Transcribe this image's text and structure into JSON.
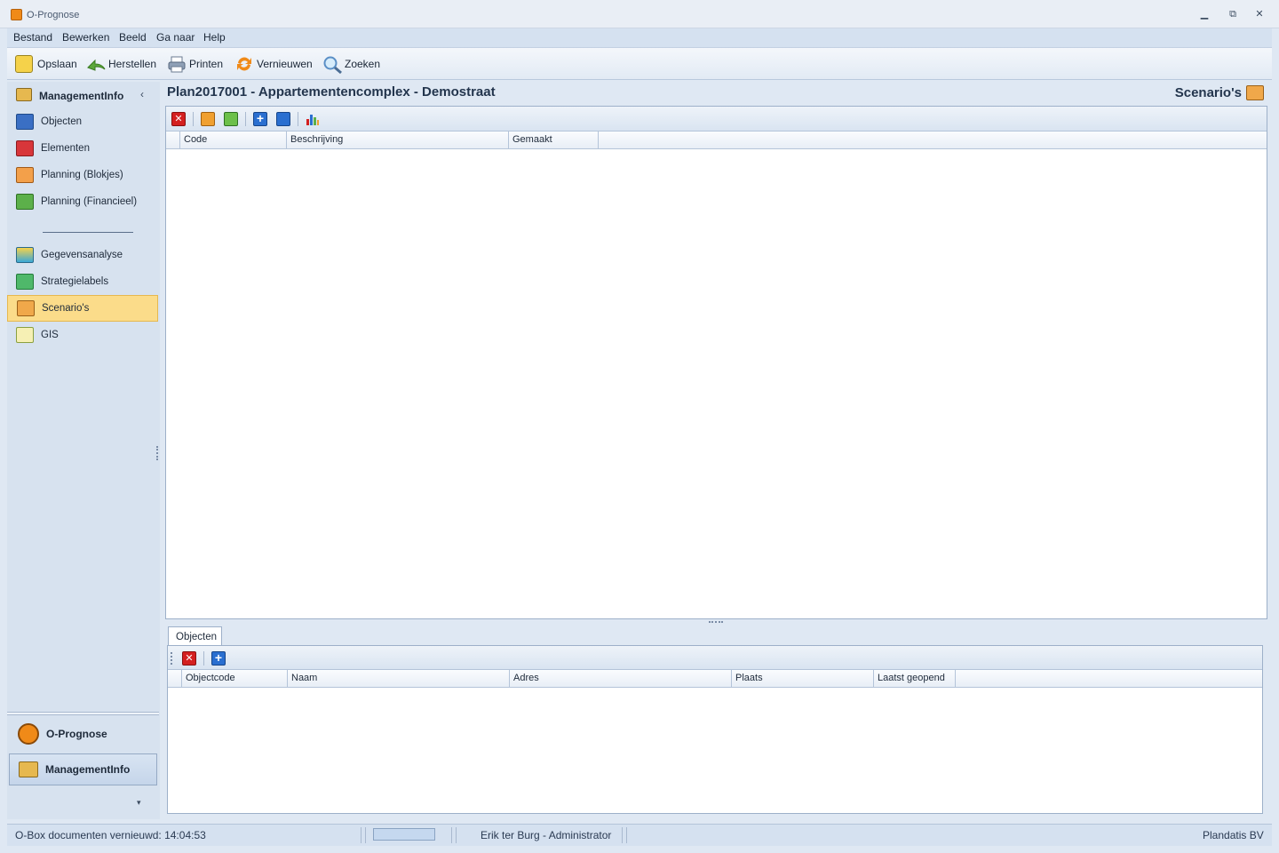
{
  "window": {
    "title": "O-Prognose",
    "controls": [
      "minimize",
      "restore",
      "close"
    ]
  },
  "menu": {
    "items": [
      "Bestand",
      "Bewerken",
      "Beeld",
      "Ga naar",
      "Help"
    ]
  },
  "toolbar": {
    "buttons": [
      {
        "label": "Opslaan",
        "icon": "save-icon"
      },
      {
        "label": "Herstellen",
        "icon": "undo-icon"
      },
      {
        "label": "Printen",
        "icon": "printer-icon"
      },
      {
        "label": "Vernieuwen",
        "icon": "refresh-icon"
      },
      {
        "label": "Zoeken",
        "icon": "search-icon"
      }
    ]
  },
  "nav": {
    "header": "ManagementInfo",
    "items": [
      {
        "label": "Objecten",
        "icon": "objects-icon"
      },
      {
        "label": "Elementen",
        "icon": "elements-icon"
      },
      {
        "label": "Planning (Blokjes)",
        "icon": "planning-blocks-icon"
      },
      {
        "label": "Planning (Financieel)",
        "icon": "planning-financial-icon"
      },
      {
        "label": "Gegevensanalyse",
        "icon": "data-analysis-icon"
      },
      {
        "label": "Strategielabels",
        "icon": "strategy-labels-icon"
      },
      {
        "label": "Scenario's",
        "icon": "scenarios-icon",
        "selected": true
      },
      {
        "label": "GIS",
        "icon": "gis-icon"
      }
    ],
    "bottom_buttons": [
      {
        "label": "O-Prognose",
        "icon": "o-prognose-icon"
      },
      {
        "label": "ManagementInfo",
        "icon": "managementinfo-icon",
        "active": true
      }
    ]
  },
  "main": {
    "title": "Plan2017001 - Appartementencomplex - Demostraat",
    "section": "Scenario's",
    "grid_columns": [
      "Code",
      "Beschrijving",
      "Gemaakt"
    ],
    "tab": "Objecten",
    "sub_columns": [
      "Objectcode",
      "Naam",
      "Adres",
      "Plaats",
      "Laatst geopend"
    ]
  },
  "status": {
    "left": "O-Box documenten vernieuwd: 14:04:53",
    "user": "Erik ter Burg - Administrator",
    "company": "Plandatis BV"
  },
  "colors": {
    "selected_nav": "#fbdc8a",
    "accent_orange": "#f08a18",
    "delete_red": "#d42020",
    "add_blue": "#2a6fd0"
  }
}
